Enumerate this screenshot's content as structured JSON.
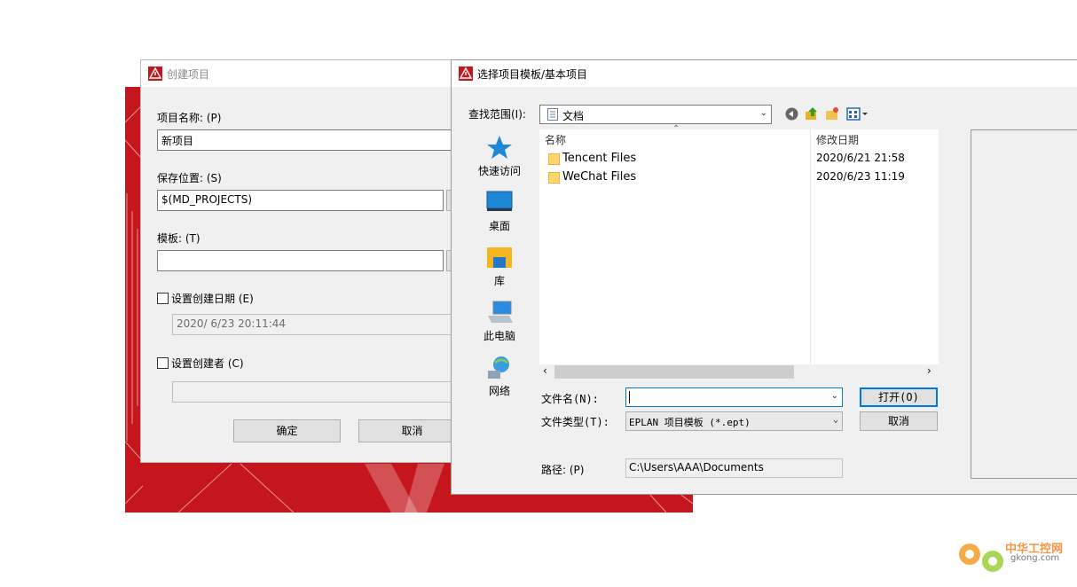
{
  "create_dialog": {
    "title": "创建项目",
    "project_name_label": "项目名称: (P)",
    "project_name_value": "新项目",
    "save_location_label": "保存位置: (S)",
    "save_location_value": "$(MD_PROJECTS)",
    "template_label": "模板: (T)",
    "template_value": "",
    "set_date_label": "设置创建日期 (E)",
    "date_value": "2020/  6/23 20:11:44",
    "set_creator_label": "设置创建者 (C)",
    "creator_value": "",
    "ok_label": "确定",
    "cancel_label": "取消"
  },
  "file_dialog": {
    "title": "选择项目模板/基本项目",
    "look_in_label": "查找范围(I):",
    "look_in_value": "文档",
    "places": [
      {
        "label": "快速访问",
        "icon": "star-icon"
      },
      {
        "label": "桌面",
        "icon": "desktop-icon"
      },
      {
        "label": "库",
        "icon": "library-icon"
      },
      {
        "label": "此电脑",
        "icon": "computer-icon"
      },
      {
        "label": "网络",
        "icon": "network-icon"
      }
    ],
    "columns": {
      "name": "名称",
      "modified": "修改日期"
    },
    "files": [
      {
        "name": "Tencent Files",
        "modified": "2020/6/21 21:58"
      },
      {
        "name": "WeChat Files",
        "modified": "2020/6/23 11:19"
      }
    ],
    "filename_label": "文件名(N):",
    "filename_value": "",
    "filetype_label": "文件类型(T):",
    "filetype_value": "EPLAN 项目模板 (*.ept)",
    "open_label": "打开(O)",
    "cancel_label": "取消",
    "path_label": "路径: (P)",
    "path_value": "C:\\Users\\AAA\\Documents"
  },
  "watermark": {
    "text": "中华工控网",
    "domain": "gkong.com"
  },
  "colors": {
    "brand_red": "#c4161c",
    "accent_blue": "#0078d7"
  }
}
